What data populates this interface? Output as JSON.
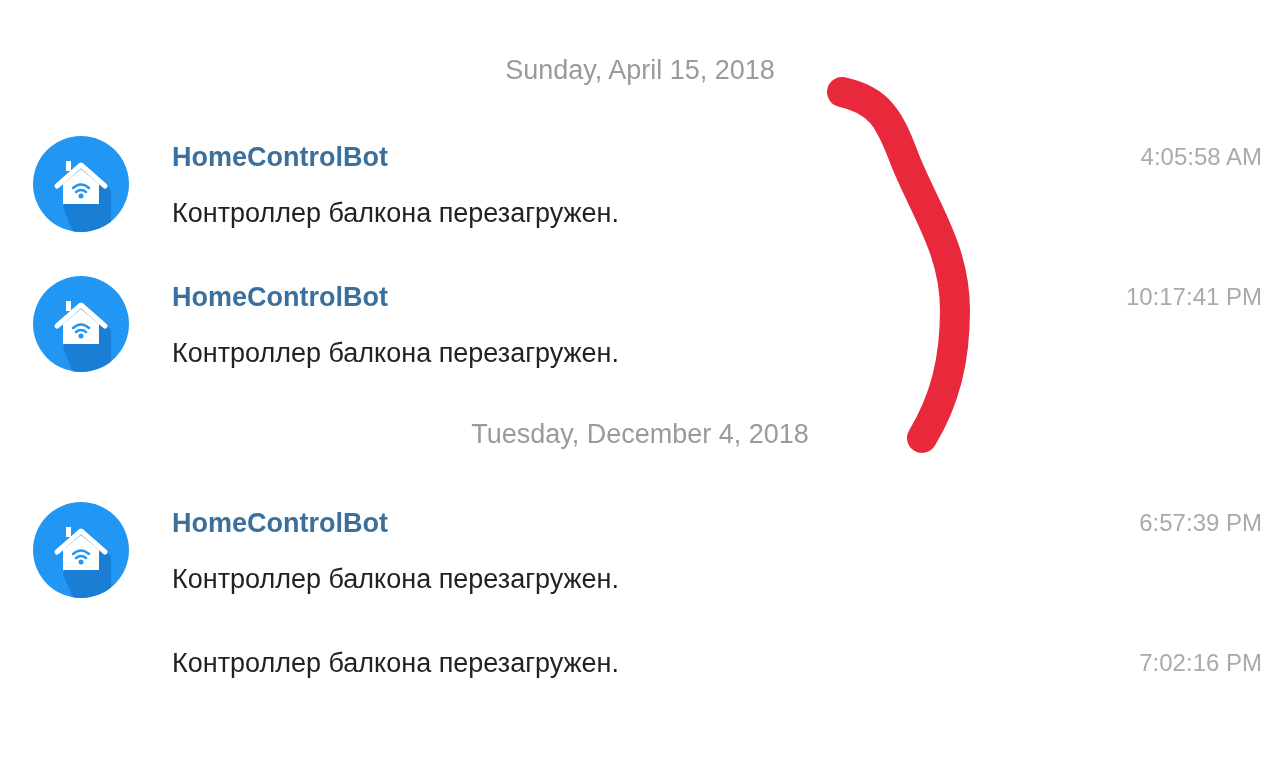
{
  "items": [
    {
      "kind": "date",
      "text": "Sunday, April 15, 2018"
    },
    {
      "kind": "message",
      "avatar": true,
      "name": "HomeControlBot",
      "text": "Контроллер балкона перезагружен.",
      "time": "4:05:58 AM"
    },
    {
      "kind": "message",
      "avatar": true,
      "name": "HomeControlBot",
      "text": "Контроллер балкона перезагружен.",
      "time": "10:17:41 PM"
    },
    {
      "kind": "date",
      "text": "Tuesday, December 4, 2018"
    },
    {
      "kind": "message",
      "avatar": true,
      "name": "HomeControlBot",
      "text": "Контроллер балкона перезагружен.",
      "time": "6:57:39 PM"
    },
    {
      "kind": "message",
      "avatar": false,
      "text": "Контроллер балкона перезагружен.",
      "time": "7:02:16 PM"
    }
  ]
}
